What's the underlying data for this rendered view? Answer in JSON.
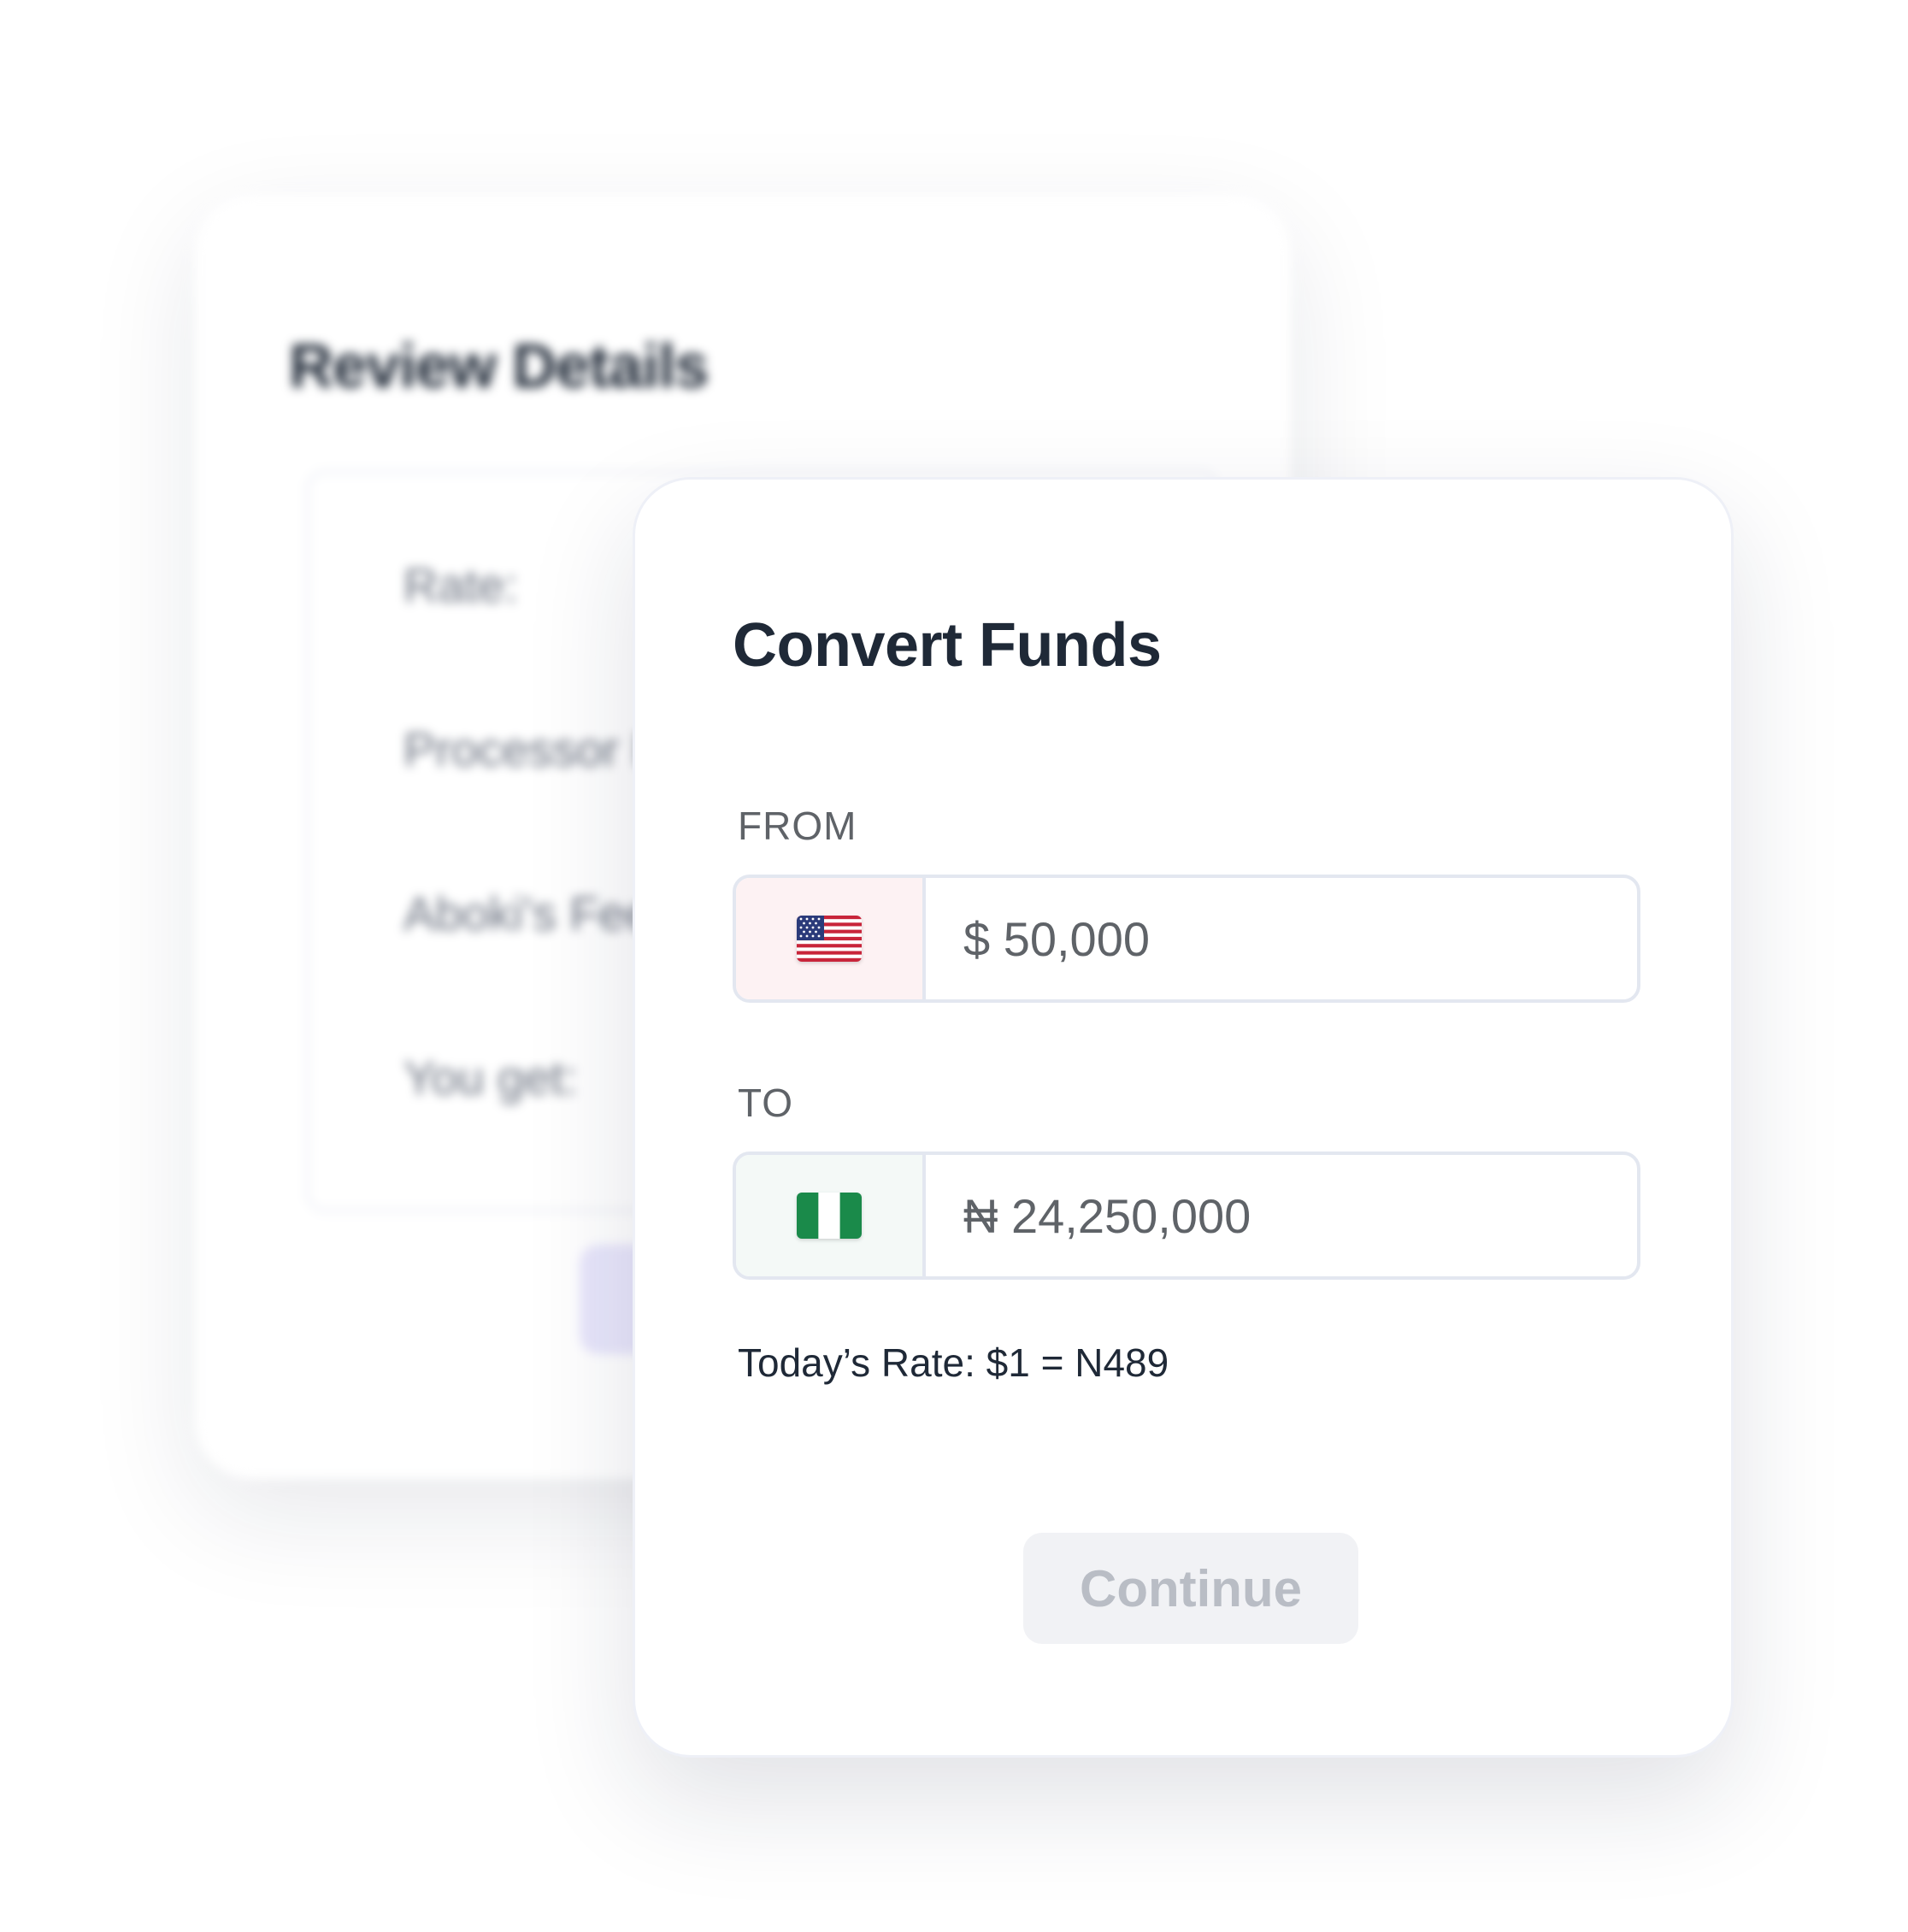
{
  "background_card": {
    "title": "Review Details",
    "rows": [
      "Rate:",
      "Processor Fee:",
      "Aboki's Fee:",
      "You get:"
    ]
  },
  "convert": {
    "title": "Convert Funds",
    "from": {
      "label": "FROM",
      "flag_icon": "us-flag-icon",
      "amount": "$ 50,000"
    },
    "to": {
      "label": "TO",
      "flag_icon": "nigeria-flag-icon",
      "amount": "₦ 24,250,000"
    },
    "rate_text": "Today’s Rate: $1 = N489",
    "continue_label": "Continue"
  },
  "colors": {
    "title_text": "#1f2937",
    "label_text": "#5f6368",
    "field_border": "#e3e7f0",
    "button_bg": "#f1f2f5",
    "button_text": "#b9bdc5",
    "us_flag_bg": "#fdf2f3",
    "ng_flag_bg": "#f4f9f7"
  }
}
